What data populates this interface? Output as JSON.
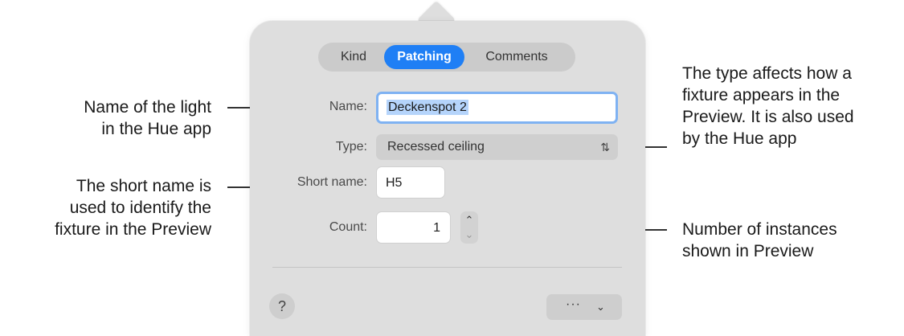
{
  "tabs": [
    {
      "label": "Kind",
      "selected": false
    },
    {
      "label": "Patching",
      "selected": true
    },
    {
      "label": "Comments",
      "selected": false
    }
  ],
  "form": {
    "name": {
      "label": "Name:",
      "value": "Deckenspot 2"
    },
    "type": {
      "label": "Type:",
      "value": "Recessed ceiling"
    },
    "short_name": {
      "label": "Short name:",
      "value": "H5"
    },
    "count": {
      "label": "Count:",
      "value": "1"
    }
  },
  "footer": {
    "help_label": "?",
    "more_label": "···"
  },
  "annotations": {
    "name_line1": "Name of the light",
    "name_line2": "in the Hue app",
    "short_line1": "The short name is",
    "short_line2": "used to identify the",
    "short_line3": "fixture in the Preview",
    "type_line1": "The type affects how a",
    "type_line2": "fixture appears in the",
    "type_line3": "Preview. It is also used",
    "type_line4": "by the Hue app",
    "count_line1": "Number of instances",
    "count_line2": "shown in Preview"
  },
  "colors": {
    "accent": "#1f7ff5",
    "popover_bg": "#dedede",
    "focus_ring": "#7fb2f2"
  },
  "icons": {
    "type_select": "up-down-chevron-icon",
    "stepper_up": "chevron-up-icon",
    "stepper_down": "chevron-down-icon",
    "more_menu": "chevron-down-icon"
  }
}
